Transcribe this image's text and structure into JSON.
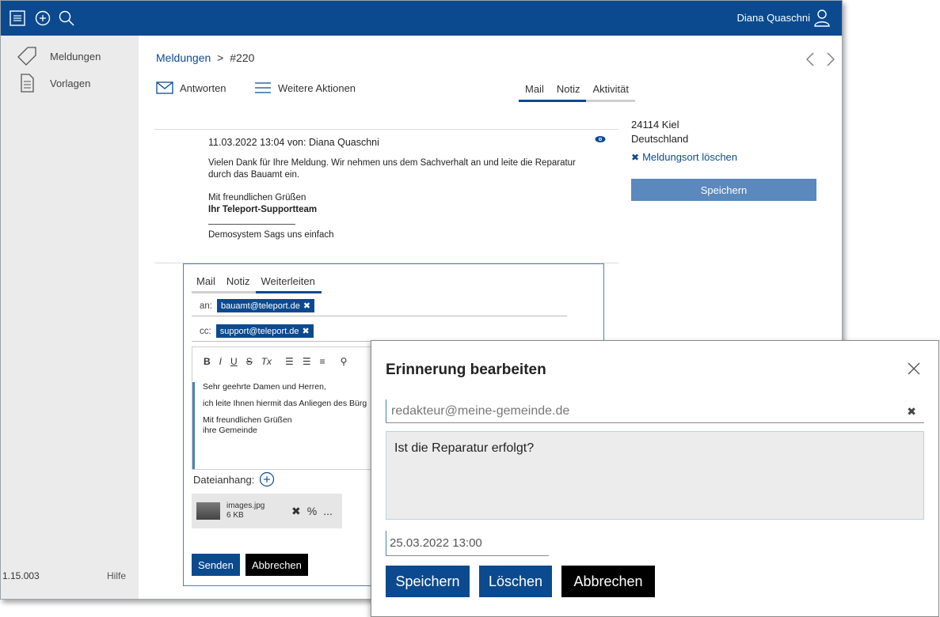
{
  "topbar": {
    "user_name": "Diana Quaschni",
    "icons": [
      "list-icon",
      "plus-circle-icon",
      "search-icon",
      "user-icon"
    ],
    "bg_color": "#0b4a8f"
  },
  "sidebar": {
    "items": [
      {
        "label": "Meldungen",
        "icon": "tag-icon"
      },
      {
        "label": "Vorlagen",
        "icon": "document-icon"
      }
    ],
    "version": "1.15.003",
    "help": "Hilfe"
  },
  "breadcrumb": {
    "parent": "Meldungen",
    "separator": ">",
    "current": "#220"
  },
  "actions": {
    "reply": "Antworten",
    "more": "Weitere Aktionen"
  },
  "view_tabs": [
    "Mail",
    "Notiz",
    "Aktivität"
  ],
  "message": {
    "header": "11.03.2022 13:04 von: Diana Quaschni",
    "body_line1": "Vielen Dank für Ihre Meldung. Wir nehmen uns dem Sachverhalt an und leite die Reparatur",
    "body_line2": "durch das Bauamt ein.",
    "greeting": "Mit freundlichen Grüßen",
    "team": "Ihr Teleport-Supportteam",
    "footer": "Demosystem Sags uns einfach"
  },
  "location": {
    "city": "24114 Kiel",
    "country": "Deutschland",
    "delete_label": "Meldungsort löschen",
    "save_label": "Speichern"
  },
  "compose": {
    "tabs": [
      "Mail",
      "Notiz",
      "Weiterleiten"
    ],
    "to_label": "an:",
    "to_chip": "bauamt@teleport.de",
    "cc_label": "cc:",
    "cc_chip": "support@teleport.de",
    "toolbar": [
      "B",
      "I",
      "U",
      "S",
      "Tx",
      "ol",
      "ul",
      "align",
      "link"
    ],
    "body_line1": "Sehr geehrte Damen und Herren,",
    "body_line2": "ich leite Ihnen hiermit das Anliegen des Bürg",
    "body_line3": "Mit freundlichen Grüßen",
    "body_line4": "ihre Gemeinde",
    "attach_label": "Dateianhang:",
    "attachment_name": "images.jpg",
    "attachment_size": "6 KB",
    "attachment_more": "...",
    "send_label": "Senden",
    "cancel_label": "Abbrechen"
  },
  "modal": {
    "title": "Erinnerung bearbeiten",
    "email": "redakteur@meine-gemeinde.de",
    "text": "Ist die Reparatur erfolgt?",
    "date": "25.03.2022 13:00",
    "save_label": "Speichern",
    "delete_label": "Löschen",
    "cancel_label": "Abbrechen"
  },
  "colors": {
    "primary": "#0b4a8f",
    "save_light": "#5b88bd",
    "black_button": "#000000"
  }
}
